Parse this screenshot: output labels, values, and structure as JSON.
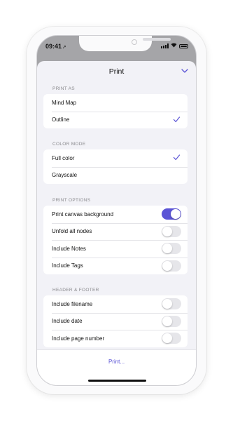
{
  "status_bar": {
    "time": "09:41",
    "location_icon": "location-arrow-icon",
    "wifi_icon": "wifi-icon",
    "battery_icon": "battery-icon"
  },
  "sheet": {
    "title": "Print",
    "close_icon": "chevron-down-icon"
  },
  "sections": [
    {
      "label": "PRINT AS",
      "rows": [
        {
          "label": "Mind Map",
          "checked": false
        },
        {
          "label": "Outline",
          "checked": true
        }
      ]
    },
    {
      "label": "COLOR MODE",
      "rows": [
        {
          "label": "Full color",
          "checked": true
        },
        {
          "label": "Grayscale",
          "checked": false
        }
      ]
    },
    {
      "label": "PRINT OPTIONS",
      "rows": [
        {
          "label": "Print canvas background",
          "toggle": true
        },
        {
          "label": "Unfold all nodes",
          "toggle": false
        },
        {
          "label": "Include Notes",
          "toggle": false
        },
        {
          "label": "Include Tags",
          "toggle": false
        }
      ]
    },
    {
      "label": "HEADER & FOOTER",
      "rows": [
        {
          "label": "Include filename",
          "toggle": false
        },
        {
          "label": "Include date",
          "toggle": false
        },
        {
          "label": "Include page number",
          "toggle": false
        }
      ]
    }
  ],
  "footer": {
    "print_label": "Print..."
  },
  "colors": {
    "accent": "#5b54d6",
    "sheet_bg": "#f2f2f7",
    "toggle_off": "#e6e6ea"
  }
}
